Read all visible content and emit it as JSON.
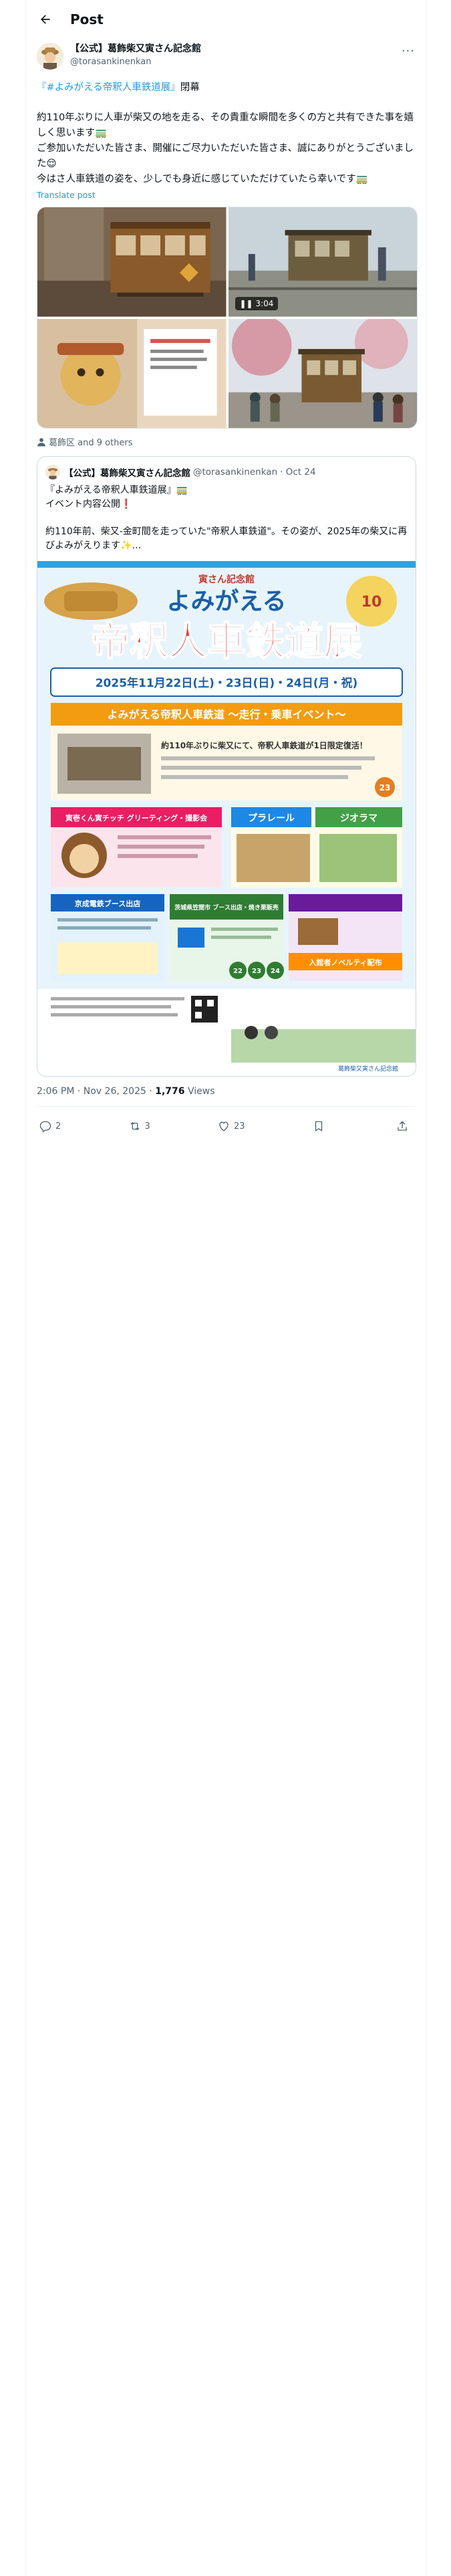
{
  "header": {
    "title": "Post"
  },
  "post": {
    "display_name": "【公式】葛飾柴又寅さん記念館",
    "handle": "@torasankinenkan",
    "line1_link": "『#よみがえる帝釈人車鉄道展』",
    "line1_rest": "閉幕",
    "para2": "約110年ぶりに人車が柴又の地を走る、その貴重な瞬間を多くの方と共有できた事を嬉しく思います🚃",
    "para3": "ご参加いただいた皆さま、開催にご尽力いただいた皆さま、誠にありがとうございました😌",
    "para4": "今はさ人車鉄道の姿を、少しでも身近に感じていただけていたら幸いです🚃",
    "translate": "Translate post",
    "video_duration": "3:04",
    "tagged": "葛飾区 and 9 others",
    "timestamp": "2:06 PM · Nov 26, 2025 ·",
    "views_count": "1,776",
    "views_label": "Views"
  },
  "quote": {
    "display_name": "【公式】葛飾柴又寅さん記念館",
    "handle": "@torasankinenkan",
    "date": "· Oct 24",
    "line1": "『よみがえる帝釈人車鉄道展』🚃",
    "line2": "イベント内容公開❗",
    "para2": "約110年前、柴又-金町間を走っていた\"帝釈人車鉄道\"。その姿が、2025年の柴又に再びよみがえります✨…"
  },
  "flyer": {
    "top_tag": "寅さん記念館",
    "title_small": "よみがえる",
    "title_big": "帝釈人車鉄道展",
    "dates": "2025年11月22日(土)・23日(日)・24日(月・祝)",
    "banner": "よみがえる帝釈人車鉄道 〜走行・乗車イベント〜",
    "desc": "約110年ぶりに柴又にて、帝釈人車鉄道が1日限定復活！",
    "sec_a": "寅壱くん寅チッチ グリーティング・撮影会",
    "sec_b": "プラレール",
    "sec_c": "ジオラマ",
    "sec_d": "京成電鉄ブース出店",
    "sec_e": "茨城県笠間市 ブース出店・焼き栗販売",
    "sec_f": "入館者ノベルティ配布",
    "footer": "葛飾柴又寅さん記念館",
    "days": [
      "22",
      "23",
      "24"
    ]
  },
  "actions": {
    "reply": "2",
    "repost": "3",
    "like": "23"
  },
  "colors": {
    "link": "#1d9bf0",
    "muted": "#536471",
    "border": "#cfd9de"
  }
}
